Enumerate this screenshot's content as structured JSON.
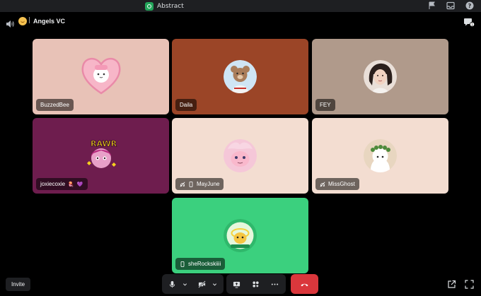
{
  "app": {
    "title": "Abstract"
  },
  "channel": {
    "name": "Angels VC",
    "separator": "|"
  },
  "participants": [
    {
      "name": "BuzzedBee",
      "bg": "#e8c2b7",
      "avatar_bg": "#f7b6c8",
      "heart_frame": true
    },
    {
      "name": "Daila",
      "bg": "#9b4527",
      "avatar_bg": "#cfe5f5"
    },
    {
      "name": "FEY",
      "bg": "#b09a8b",
      "avatar_bg": "#e9dfd8"
    },
    {
      "name": "joxiecoxie",
      "bg": "#6e1d4e",
      "avatar_bg": "#8c2a6b",
      "badges": [
        "🪼",
        "💜"
      ]
    },
    {
      "name": "MayJune",
      "bg": "#f3ddd1",
      "avatar_bg": "#f5c7d8",
      "status_icons": [
        "deafened-icon",
        "mobile-icon"
      ]
    },
    {
      "name": "MissGhost",
      "bg": "#f3ddd1",
      "avatar_bg": "#e8d6c0",
      "status_icons": [
        "deafened-icon"
      ]
    },
    {
      "name": "sheRockskiiii",
      "bg": "#3bd07e",
      "avatar_bg": "#2fb86b",
      "status_icons": [
        "mobile-icon"
      ]
    }
  ],
  "controls": {
    "invite_label": "Invite",
    "microphone": "microphone-icon",
    "camera": "camera-off-icon",
    "screen_share": "screen-share-icon",
    "activities": "activities-icon",
    "more": "more-icon",
    "end_call": "hangup-icon",
    "end_call_color": "#da373c"
  },
  "colors": {
    "background": "#000000",
    "titlebar": "#1e1f22",
    "accent_green": "#23a55a"
  }
}
